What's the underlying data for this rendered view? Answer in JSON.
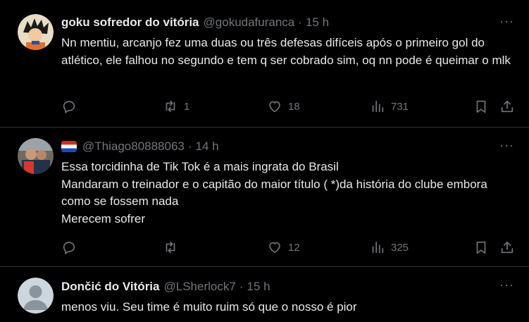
{
  "tweets": [
    {
      "name": "goku sofredor do vitória",
      "handle": "@gokudafuranca",
      "sep": "·",
      "time": "15 h",
      "more": "···",
      "text": "Nn mentiu, arcanjo fez uma duas ou três defesas difíceis após o primeiro gol do atlético, ele falhou no segundo e tem q ser cobrado sim, oq nn pode é queimar o mlk",
      "replies": "",
      "reposts": "1",
      "likes": "18",
      "views": "731"
    },
    {
      "name": "",
      "handle": "@Thiago80888063",
      "sep": "·",
      "time": "14 h",
      "more": "···",
      "lines": [
        "Essa torcidinha de Tik Tok é a mais ingrata do Brasil",
        "Mandaram o treinador e o capitão do maior título ( *)da história do clube embora como se fossem nada",
        "Merecem sofrer"
      ],
      "replies": "",
      "reposts": "",
      "likes": "12",
      "views": "325"
    },
    {
      "name": "Dončić do Vitória",
      "handle": "@LSherlock7",
      "sep": "·",
      "time": "15 h",
      "more": "···",
      "text": "menos viu. Seu time é muito ruim só que o nosso é pior"
    }
  ],
  "colors": {
    "background": "#000000",
    "text": "#e7e9ea",
    "muted": "#71767b",
    "divider": "#2f3336"
  }
}
